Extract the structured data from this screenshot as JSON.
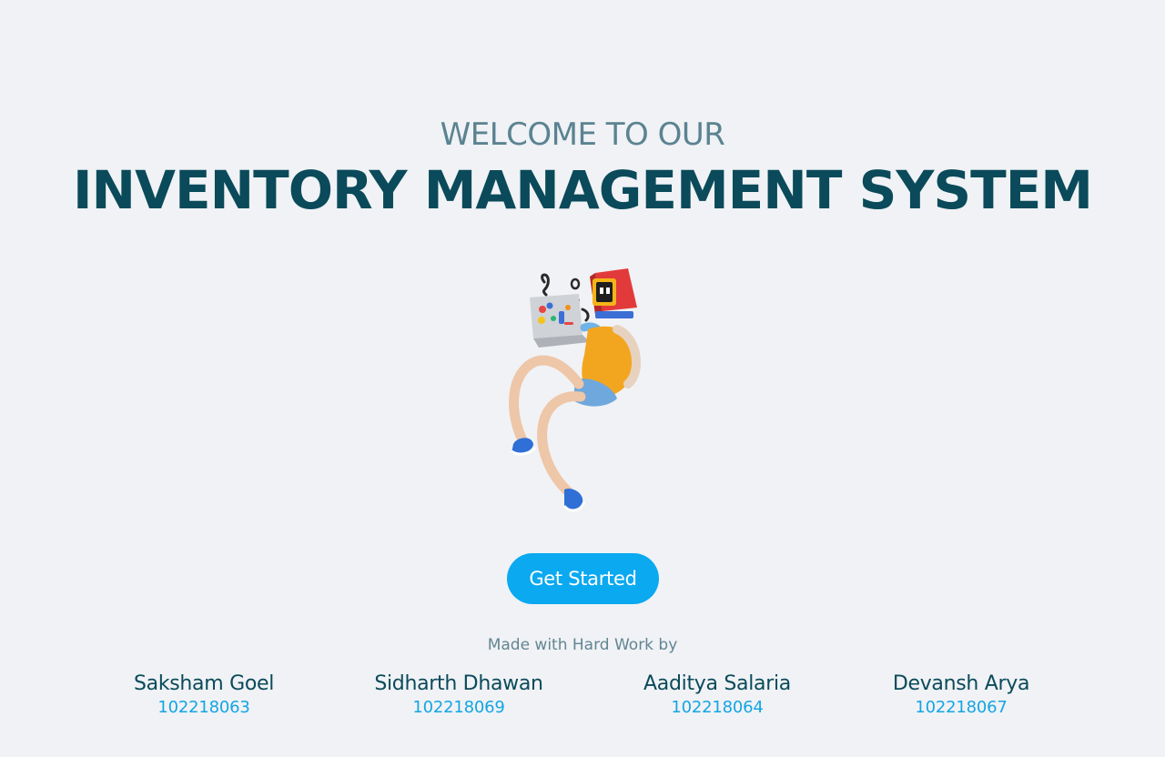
{
  "hero": {
    "welcome": "WELCOME TO OUR",
    "title": "INVENTORY MANAGEMENT SYSTEM",
    "illustration": "3d-character-with-laptop-illustration"
  },
  "cta": {
    "label": "Get Started"
  },
  "credits": {
    "made_by": "Made with Hard Work by",
    "members": [
      {
        "name": "Saksham Goel",
        "id": "102218063"
      },
      {
        "name": "Sidharth Dhawan",
        "id": "102218069"
      },
      {
        "name": "Aaditya Salaria",
        "id": "102218064"
      },
      {
        "name": "Devansh Arya",
        "id": "102218067"
      }
    ]
  },
  "colors": {
    "background": "#f0f2f5",
    "heading": "#0a4a5a",
    "subheading": "#5b8391",
    "accent": "#0aa9f0"
  }
}
